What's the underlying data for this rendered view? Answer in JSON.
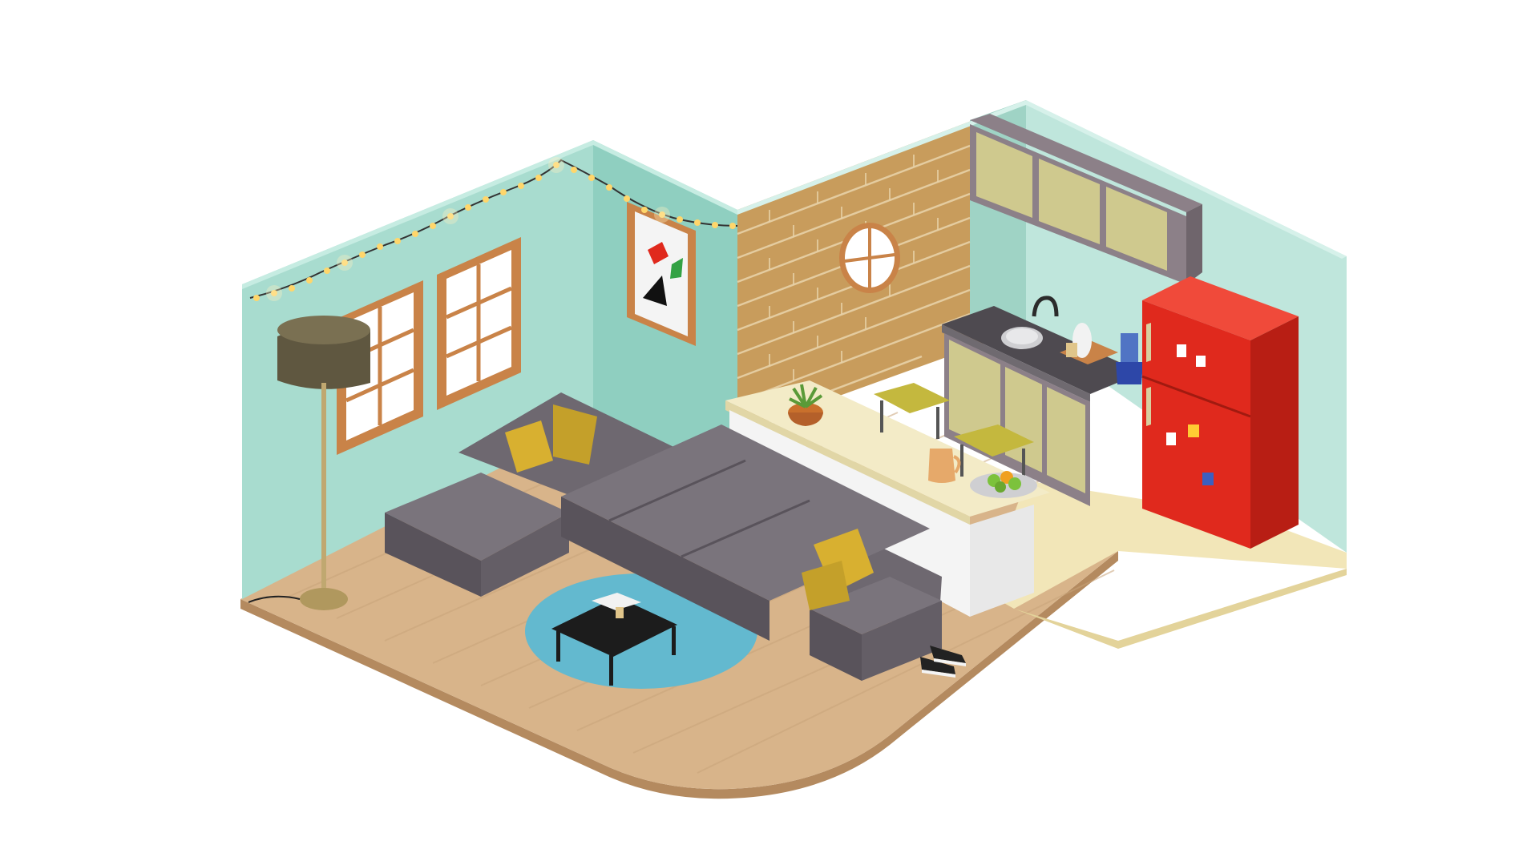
{
  "scene": {
    "background": "#ffffff",
    "description_kind": "isometric-3d-render",
    "colors": {
      "wall_mint": "#a8dccf",
      "wall_mint_dark": "#8fcfc0",
      "wall_mint_top": "#c6ece2",
      "brick": "#c89c5c",
      "brick_mortar": "#e8d2a8",
      "floor_wood": "#d8b48a",
      "floor_wood_edge": "#b48a5f",
      "kitchen_floor": "#f2e6b8",
      "sofa": "#6e6870",
      "sofa_dark": "#59535b",
      "pillow": "#d8b030",
      "rug": "#63b9cf",
      "fridge": "#e0291d",
      "fridge_dark": "#b81e14",
      "cabinet": "#cfc98e",
      "cabinet_frame": "#8c8088",
      "counter_top": "#f3ebc7",
      "lamp_shade": "#5f5740",
      "window_frame": "#c98348",
      "fairy_light": "#ffd66b"
    }
  }
}
